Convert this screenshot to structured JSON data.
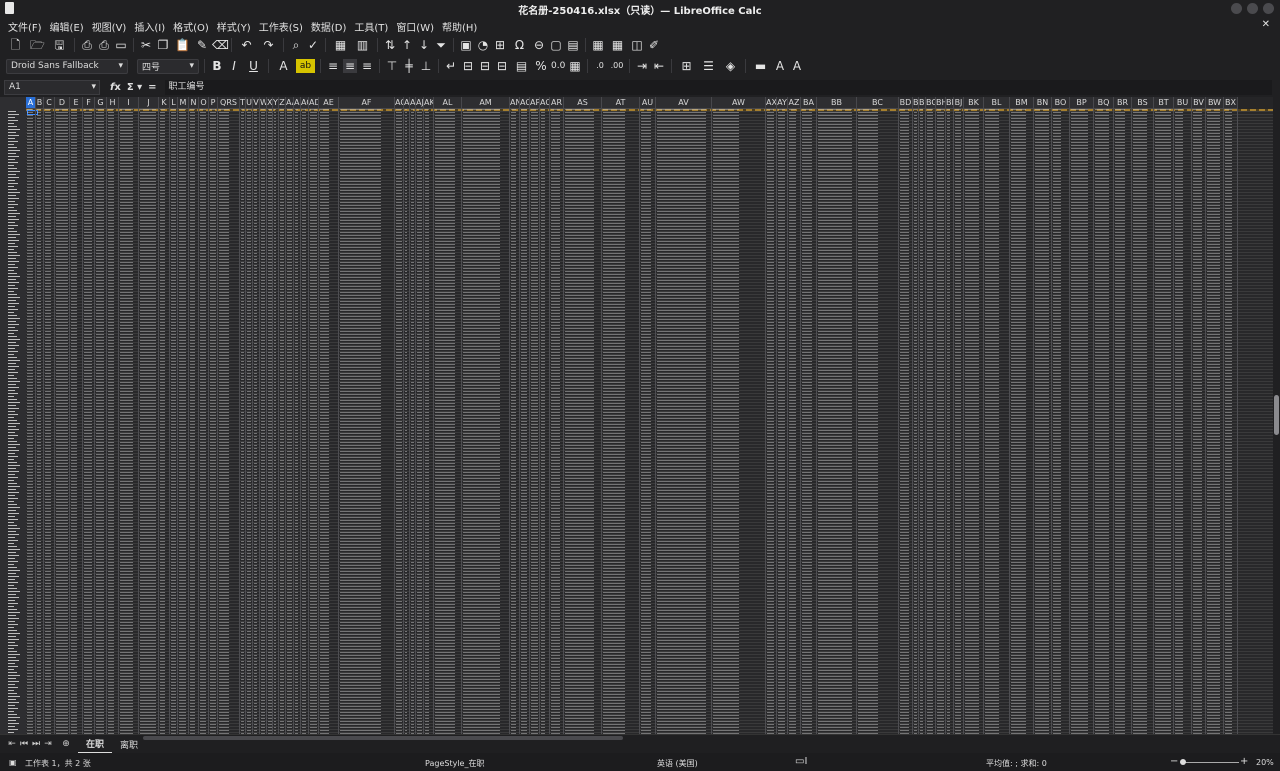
{
  "window": {
    "title": "花名册-250416.xlsx（只读）— LibreOffice Calc"
  },
  "menu": [
    "文件(F)",
    "编辑(E)",
    "视图(V)",
    "插入(I)",
    "格式(O)",
    "样式(Y)",
    "工作表(S)",
    "数据(D)",
    "工具(T)",
    "窗口(W)",
    "帮助(H)"
  ],
  "formatting": {
    "font_name": "Droid Sans Fallback",
    "font_size": "四号"
  },
  "formula_bar": {
    "cell_ref": "A1",
    "content": "职工编号"
  },
  "columns": [
    "A",
    "B",
    "C",
    "D",
    "E",
    "F",
    "G",
    "H",
    "I",
    "J",
    "K",
    "L",
    "M",
    "N",
    "O",
    "P",
    "Q",
    "R",
    "S",
    "T",
    "U",
    "V",
    "W",
    "X",
    "Y",
    "Z",
    "AA",
    "AB",
    "AC",
    "AD",
    "AE",
    "AF",
    "AG",
    "AH",
    "AI",
    "AJ",
    "AK",
    "AL",
    "AM",
    "AN",
    "AO",
    "AP",
    "AQ",
    "AR",
    "AS",
    "AT",
    "AU",
    "AV",
    "AW",
    "AX",
    "AY",
    "AZ",
    "BA",
    "BB",
    "BC",
    "BD",
    "BE",
    "BF",
    "BG",
    "BH",
    "BI",
    "BJ",
    "BK",
    "BL",
    "BM",
    "BN",
    "BO",
    "BP",
    "BQ",
    "BR",
    "BS",
    "BT",
    "BU",
    "BV",
    "BW",
    "BX"
  ],
  "column_labels": [
    "A",
    "B",
    "C",
    "D",
    "E",
    "F",
    "G",
    "H",
    "I",
    "J",
    "K",
    "L",
    "M",
    "N",
    "O",
    "P",
    "QRS",
    "T",
    "U",
    "V",
    "W",
    "X",
    "Y",
    "Z",
    "AA",
    "AB",
    "AC",
    "AD",
    "AE",
    "AF",
    "AG",
    "AH",
    "AI",
    "AJ",
    "AK",
    "AL",
    "AM",
    "AN",
    "AO",
    "AP",
    "AQ",
    "AR",
    "AS",
    "AT",
    "AU",
    "AV",
    "AW",
    "AX",
    "AY",
    "AZ",
    "BA",
    "BB",
    "BC",
    "BD",
    "BE",
    "BF",
    "BG",
    "BH",
    "BI",
    "BJ",
    "BK",
    "BL",
    "BM",
    "BN",
    "BO",
    "BP",
    "BQ",
    "BR",
    "BS",
    "BT",
    "BU",
    "BV",
    "BW",
    "BX"
  ],
  "selected_column": "A",
  "sheet_tabs": [
    {
      "label": "在职",
      "active": true
    },
    {
      "label": "离职",
      "active": false
    }
  ],
  "status": {
    "sheet_info": "工作表 1，共 2 张",
    "page_style": "PageStyle_在职",
    "language": "英语 (美国)",
    "selection_summary": "平均值: ; 求和: 0",
    "zoom": "20%"
  },
  "icons": [
    "new-doc-icon",
    "open-icon",
    "save-icon",
    "export-pdf-icon",
    "print-icon",
    "print-preview-icon",
    "cut-icon",
    "copy-icon",
    "paste-icon",
    "clone-format-icon",
    "clear-format-icon",
    "undo-icon",
    "redo-icon",
    "find-icon",
    "spelling-icon",
    "row-icon",
    "column-icon",
    "sort-icon",
    "sort-asc-icon",
    "sort-desc-icon",
    "autofilter-icon",
    "image-icon",
    "chart-icon",
    "pivot-icon",
    "special-char-icon",
    "hyperlink-icon",
    "comment-icon",
    "header-footer-icon",
    "define-print-area-icon",
    "freeze-icon",
    "split-window-icon",
    "show-draw-icon"
  ]
}
